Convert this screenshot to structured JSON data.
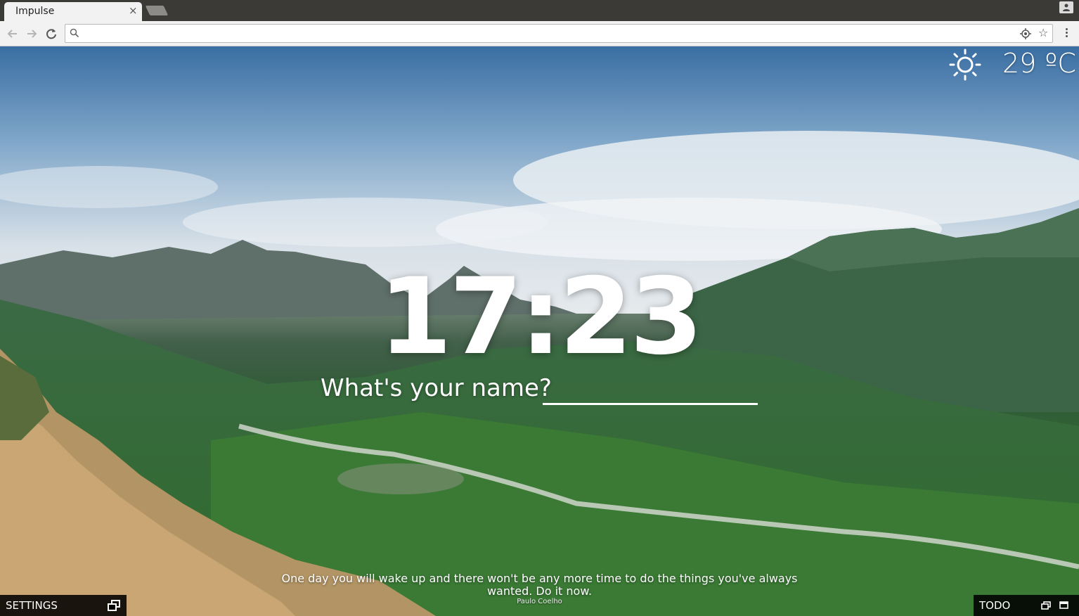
{
  "browser": {
    "tab_title": "Impulse",
    "tab_close": "×",
    "omnibox_value": "",
    "bookmark_star": "☆"
  },
  "widgets": {
    "weather_icon": "sun-icon",
    "temperature": "29 ºC",
    "clock": "17:23",
    "name_prompt": "What's your name?",
    "name_value": ""
  },
  "quote": {
    "text": "One day you will wake up and there won't be any more time to do the things you've always wanted. Do it now.",
    "author": "Paulo Coelho"
  },
  "panels": {
    "settings_label": "SETTINGS",
    "todo_label": "TODO"
  },
  "colors": {
    "chrome_tabbar": "#3b3a37",
    "chrome_toolbar": "#f2f2f2",
    "panel_bg": "#000000",
    "text_overlay": "#ffffff"
  }
}
